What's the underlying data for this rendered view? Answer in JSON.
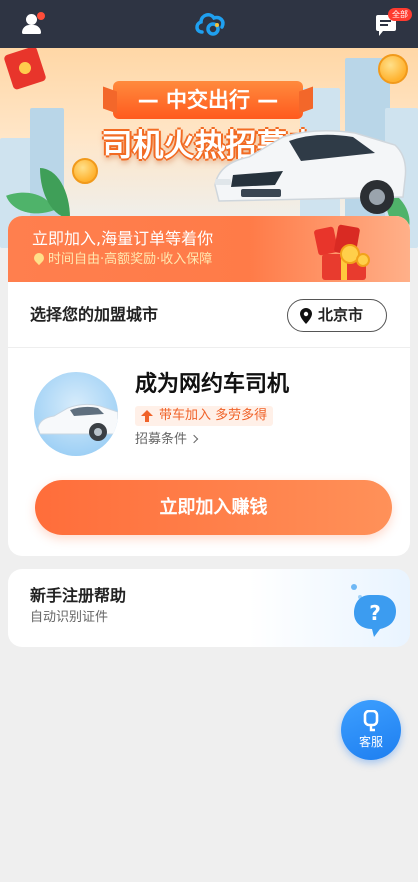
{
  "topbar": {
    "badge": "全部",
    "icons": [
      "user-icon",
      "cloud-logo-icon",
      "message-icon"
    ]
  },
  "banner": {
    "brand": "— 中交出行 —",
    "slogan": "司机火热招募中"
  },
  "promo": {
    "title": "立即加入,海量订单等着你",
    "subtitle": "时间自由·高额奖励·收入保障"
  },
  "city": {
    "label": "选择您的加盟城市",
    "value": "北京市"
  },
  "driver": {
    "title": "成为网约车司机",
    "tag": "带车加入 多劳多得",
    "link": "招募条件"
  },
  "join_button": "立即加入赚钱",
  "help": {
    "title": "新手注册帮助",
    "subtitle": "自动识别证件"
  },
  "service": {
    "label": "客服"
  },
  "colors": {
    "topbar": "#2e3443",
    "accent": "#ff7a45",
    "fab": "#1d7ef0",
    "background": "#efefef"
  }
}
